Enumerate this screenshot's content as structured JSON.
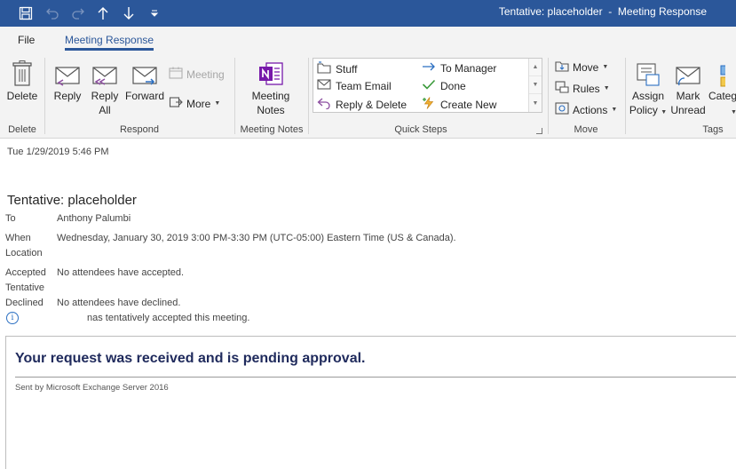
{
  "window": {
    "title": "Tentative: placeholder  -  Meeting Response",
    "quick_access": [
      "save-icon",
      "undo-icon",
      "redo-icon",
      "up-arrow-icon",
      "down-arrow-icon",
      "customize-icon"
    ]
  },
  "tabs": [
    {
      "label": "File",
      "active": false
    },
    {
      "label": "Meeting Response",
      "active": true
    }
  ],
  "ribbon": {
    "delete_group": {
      "delete_label": "Delete",
      "group_label": "Delete"
    },
    "respond_group": {
      "reply_label": "Reply",
      "reply_all_line1": "Reply",
      "reply_all_line2": "All",
      "forward_label": "Forward",
      "meeting_label": "Meeting",
      "more_label": "More",
      "group_label": "Respond"
    },
    "notes_group": {
      "line1": "Meeting",
      "line2": "Notes",
      "group_label": "Meeting Notes"
    },
    "quick_steps": {
      "items": [
        "Stuff",
        "Team Email",
        "Reply & Delete",
        "To Manager",
        "Done",
        "Create New"
      ],
      "group_label": "Quick Steps"
    },
    "move_group": {
      "move_label": "Move",
      "rules_label": "Rules",
      "actions_label": "Actions",
      "group_label": "Move"
    },
    "tags_group": {
      "assign_line1": "Assign",
      "assign_line2": "Policy",
      "mark_line1": "Mark",
      "mark_line2": "Unread",
      "categ_label": "Categ",
      "group_label": "Tags"
    }
  },
  "message": {
    "date": "Tue 1/29/2019 5:46 PM",
    "subject": "Tentative: placeholder",
    "to_label": "To",
    "to_value": "Anthony Palumbi",
    "when_label": "When",
    "when_value": "Wednesday, January 30, 2019 3:00 PM-3:30 PM (UTC-05:00) Eastern Time (US & Canada).",
    "location_label": "Location",
    "accepted_label": "Accepted",
    "accepted_value": "No attendees have accepted.",
    "tentative_label": "Tentative",
    "declined_label": "Declined",
    "declined_value": "No attendees have declined.",
    "info_text": "nas tentatively accepted this meeting.",
    "body_heading": "Your request was received and is pending approval.",
    "body_footer": "Sent by Microsoft Exchange Server 2016"
  },
  "colors": {
    "accent": "#2b579a",
    "ribbon_bg": "#f3f3f3",
    "body_heading": "#1f2a5c"
  }
}
